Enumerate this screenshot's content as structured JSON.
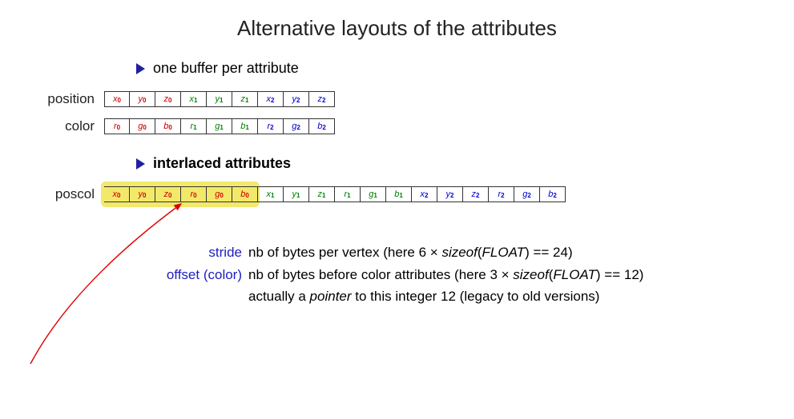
{
  "title": "Alternative layouts of the attributes",
  "bullets": {
    "one_buffer": "one buffer per attribute",
    "interlaced": "interlaced attributes"
  },
  "labels": {
    "position": "position",
    "color": "color",
    "poscol": "poscol"
  },
  "buffers": {
    "position": [
      {
        "sym": "x",
        "sub": "0",
        "cls": "c-red"
      },
      {
        "sym": "y",
        "sub": "0",
        "cls": "c-red"
      },
      {
        "sym": "z",
        "sub": "0",
        "cls": "c-red"
      },
      {
        "sym": "x",
        "sub": "1",
        "cls": "c-green"
      },
      {
        "sym": "y",
        "sub": "1",
        "cls": "c-green"
      },
      {
        "sym": "z",
        "sub": "1",
        "cls": "c-green"
      },
      {
        "sym": "x",
        "sub": "2",
        "cls": "c-blue"
      },
      {
        "sym": "y",
        "sub": "2",
        "cls": "c-blue"
      },
      {
        "sym": "z",
        "sub": "2",
        "cls": "c-blue"
      }
    ],
    "color": [
      {
        "sym": "r",
        "sub": "0",
        "cls": "c-red"
      },
      {
        "sym": "g",
        "sub": "0",
        "cls": "c-red"
      },
      {
        "sym": "b",
        "sub": "0",
        "cls": "c-red"
      },
      {
        "sym": "r",
        "sub": "1",
        "cls": "c-green"
      },
      {
        "sym": "g",
        "sub": "1",
        "cls": "c-green"
      },
      {
        "sym": "b",
        "sub": "1",
        "cls": "c-green"
      },
      {
        "sym": "r",
        "sub": "2",
        "cls": "c-blue"
      },
      {
        "sym": "g",
        "sub": "2",
        "cls": "c-blue"
      },
      {
        "sym": "b",
        "sub": "2",
        "cls": "c-blue"
      }
    ],
    "poscol": [
      {
        "sym": "x",
        "sub": "0",
        "cls": "c-red"
      },
      {
        "sym": "y",
        "sub": "0",
        "cls": "c-red"
      },
      {
        "sym": "z",
        "sub": "0",
        "cls": "c-red"
      },
      {
        "sym": "r",
        "sub": "0",
        "cls": "c-red"
      },
      {
        "sym": "g",
        "sub": "0",
        "cls": "c-red"
      },
      {
        "sym": "b",
        "sub": "0",
        "cls": "c-red"
      },
      {
        "sym": "x",
        "sub": "1",
        "cls": "c-green"
      },
      {
        "sym": "y",
        "sub": "1",
        "cls": "c-green"
      },
      {
        "sym": "z",
        "sub": "1",
        "cls": "c-green"
      },
      {
        "sym": "r",
        "sub": "1",
        "cls": "c-green"
      },
      {
        "sym": "g",
        "sub": "1",
        "cls": "c-green"
      },
      {
        "sym": "b",
        "sub": "1",
        "cls": "c-green"
      },
      {
        "sym": "x",
        "sub": "2",
        "cls": "c-blue"
      },
      {
        "sym": "y",
        "sub": "2",
        "cls": "c-blue"
      },
      {
        "sym": "z",
        "sub": "2",
        "cls": "c-blue"
      },
      {
        "sym": "r",
        "sub": "2",
        "cls": "c-blue"
      },
      {
        "sym": "g",
        "sub": "2",
        "cls": "c-blue"
      },
      {
        "sym": "b",
        "sub": "2",
        "cls": "c-blue"
      }
    ]
  },
  "defs": {
    "stride": {
      "term": "stride",
      "text_pre": "nb of bytes per vertex (here 6 × ",
      "sizeof": "sizeof",
      "float": "FLOAT",
      "text_post": " == 24)"
    },
    "offset": {
      "term": "offset (color)",
      "text_pre": "nb of bytes before color attributes (here 3 × ",
      "sizeof": "sizeof",
      "float": "FLOAT",
      "text_post": " == 12)",
      "line2_pre": "actually a ",
      "pointer": "pointer",
      "line2_post": " to this integer 12 (legacy to old versions)"
    }
  }
}
